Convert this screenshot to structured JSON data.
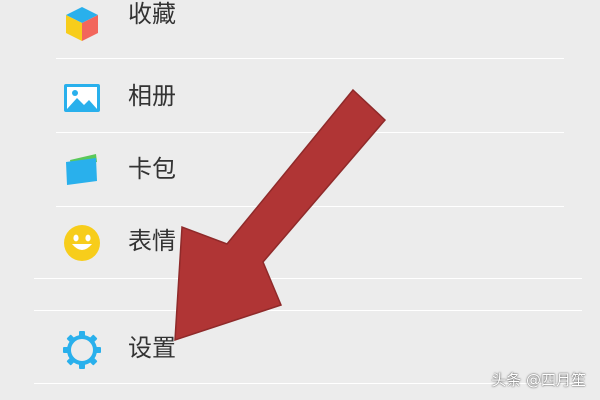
{
  "menu": {
    "items": [
      {
        "label": "收藏",
        "icon": "favorites-cube-icon"
      },
      {
        "label": "相册",
        "icon": "album-picture-icon"
      },
      {
        "label": "卡包",
        "icon": "card-wallet-icon"
      },
      {
        "label": "表情",
        "icon": "smiley-face-icon"
      },
      {
        "label": "设置",
        "icon": "gear-icon"
      }
    ]
  },
  "annotation": {
    "arrow_color": "#b03535",
    "points_to": "设置"
  },
  "watermark": {
    "text": "头条 @四月笙"
  },
  "colors": {
    "background": "#ececec",
    "divider": "#ffffff",
    "label_text": "#333333",
    "icon_blue": "#29b0ec",
    "icon_yellow": "#f7cd1b",
    "icon_red": "#f2665c",
    "icon_green": "#5ac85a"
  }
}
